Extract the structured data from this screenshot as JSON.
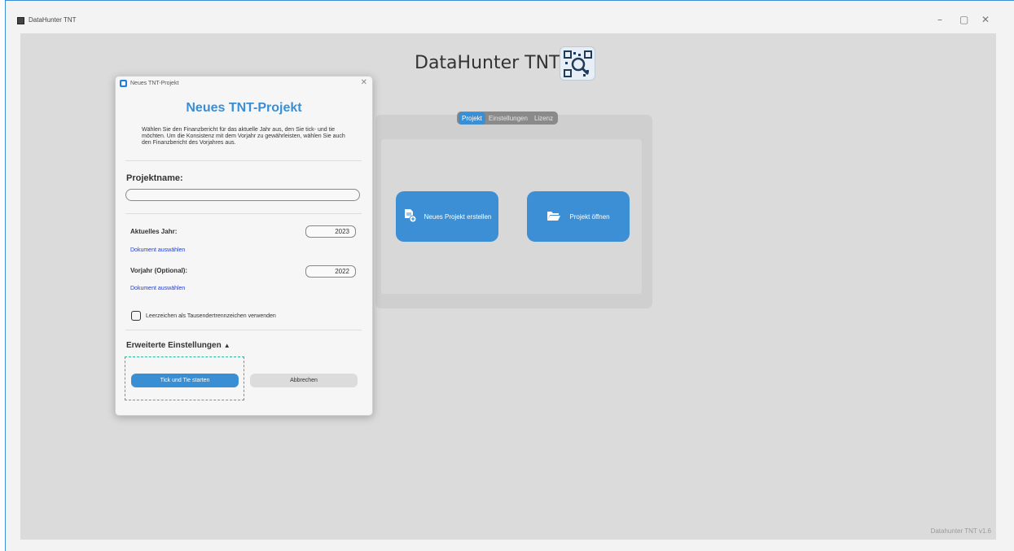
{
  "window": {
    "title": "DataHunter TNT",
    "controls": {
      "minimize": "–",
      "maximize": "▢",
      "close": "✕"
    }
  },
  "main": {
    "heading": "DataHunter TNT",
    "tabs": [
      {
        "label": "Projekt",
        "active": true
      },
      {
        "label": "Einstellungen",
        "active": false
      },
      {
        "label": "Lizenz",
        "active": false
      }
    ],
    "new_project_label": "Neues Projekt erstellen",
    "open_project_label": "Projekt öffnen",
    "version": "Datahunter TNT v1.6"
  },
  "dialog": {
    "title": "Neues TNT-Projekt",
    "heading": "Neues TNT-Projekt",
    "description": "Wählen Sie den Finanzbericht für das aktuelle Jahr aus, den Sie tick- und tie möchten. Um die Konsistenz mit dem Vorjahr zu gewährleisten, wählen Sie auch den Finanzbericht des Vorjahres aus.",
    "project_name_label": "Projektname:",
    "project_name_value": "",
    "current_year_label": "Aktuelles Jahr:",
    "current_year_value": "2023",
    "current_year_link": "Dokument auswählen",
    "previous_year_label": "Vorjahr (Optional):",
    "previous_year_value": "2022",
    "previous_year_link": "Dokument auswählen",
    "checkbox_label": "Leerzeichen als Tausendertrennzeichen verwenden",
    "checkbox_checked": false,
    "advanced_label": "Erweiterte Einstellungen",
    "advanced_arrow": "▲",
    "start_button": "Tick und Tie starten",
    "cancel_button": "Abbrechen"
  },
  "colors": {
    "accent": "#3a8ed4",
    "link": "#1f3fd0",
    "focus_outline": "#2fb59a",
    "background": "#dbdbdb"
  }
}
